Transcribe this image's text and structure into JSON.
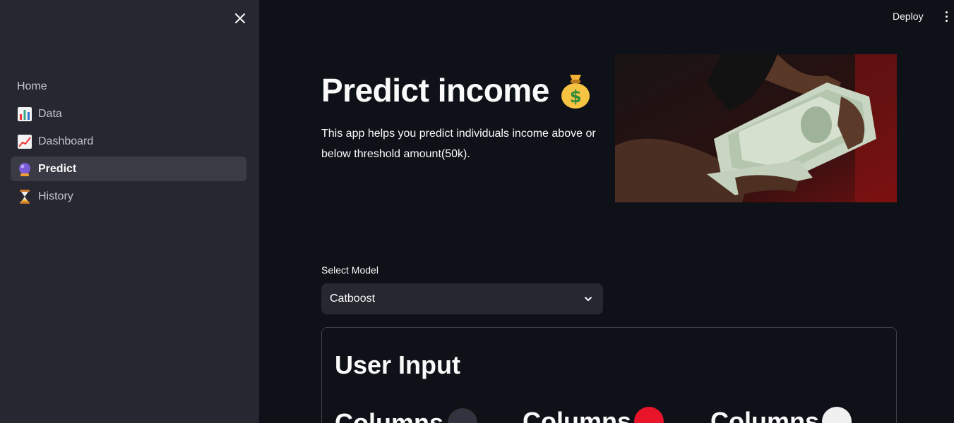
{
  "sidebar": {
    "items": [
      {
        "label": "Home",
        "icon": "none"
      },
      {
        "label": "Data",
        "icon": "bar-chart-icon"
      },
      {
        "label": "Dashboard",
        "icon": "chart-increasing-icon"
      },
      {
        "label": "Predict",
        "icon": "crystal-ball-icon",
        "active": true
      },
      {
        "label": "History",
        "icon": "hourglass-icon"
      }
    ]
  },
  "header": {
    "deploy_label": "Deploy"
  },
  "main": {
    "title": "Predict income",
    "title_icon": "money-bag-icon",
    "description": "This app helps you predict individuals income above or below threshold amount(50k).",
    "select_model": {
      "label": "Select Model",
      "value": "Catboost"
    },
    "user_input": {
      "title": "User Input",
      "columns": [
        {
          "label": "Columns",
          "dot_color": "#31333f"
        },
        {
          "label": "Columns",
          "dot_color": "#ff2b2b"
        },
        {
          "label": "Columns",
          "dot_color": "#f0f0f0"
        }
      ]
    }
  },
  "colors": {
    "background": "#0e1117",
    "sidebar": "#262730",
    "accent": "#ff4b4b"
  }
}
